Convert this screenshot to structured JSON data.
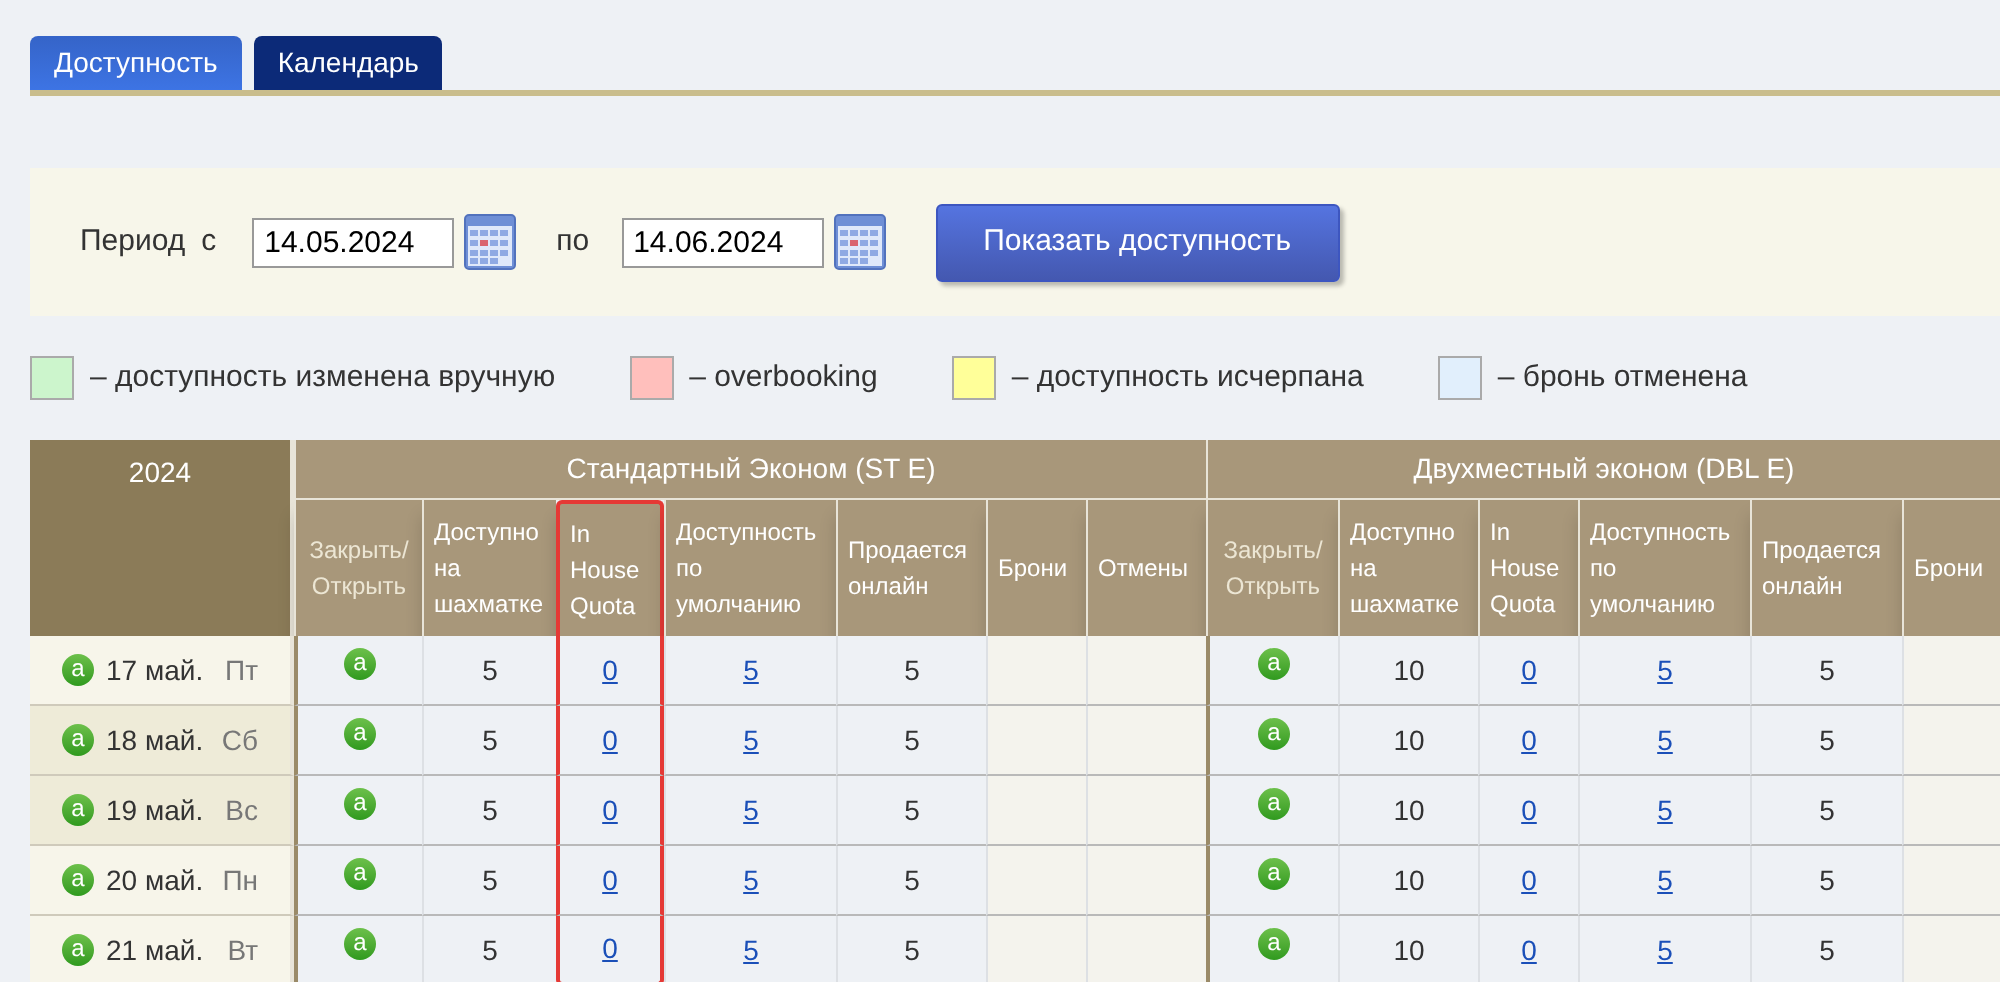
{
  "tabs": [
    {
      "label": "Доступность",
      "selected": true
    },
    {
      "label": "Календарь",
      "selected": false
    }
  ],
  "filter": {
    "period_label": "Период",
    "from_label": "с",
    "from_value": "14.05.2024",
    "to_label": "по",
    "to_value": "14.06.2024",
    "button": "Показать доступность"
  },
  "legend": [
    {
      "color": "#ccf5cc",
      "label": "– доступность изменена вручную"
    },
    {
      "color": "#ffbfbc",
      "label": "– overbooking"
    },
    {
      "color": "#ffff99",
      "label": "– доступность исчерпана"
    },
    {
      "color": "#e1effc",
      "label": "– бронь отменена"
    }
  ],
  "table": {
    "year": "2024",
    "groups": [
      {
        "name": "Стандартный Эконом (ST E)",
        "columns": [
          {
            "label": "Закрыть/ Открыть",
            "highlighted": false
          },
          {
            "label": "Доступно на шахматке",
            "highlighted": false
          },
          {
            "label": "In House Quota",
            "highlighted": true
          },
          {
            "label": "Доступность по умолчанию",
            "highlighted": false
          },
          {
            "label": "Продается онлайн",
            "highlighted": false
          },
          {
            "label": "Брони",
            "highlighted": false
          },
          {
            "label": "Отмены",
            "highlighted": false
          }
        ]
      },
      {
        "name": "Двухместный эконом (DBL E)",
        "columns": [
          {
            "label": "Закрыть/ Открыть",
            "highlighted": false
          },
          {
            "label": "Доступно на шахматке",
            "highlighted": false
          },
          {
            "label": "In House Quota",
            "highlighted": false
          },
          {
            "label": "Доступность по умолчанию",
            "highlighted": false
          },
          {
            "label": "Продается онлайн",
            "highlighted": false
          },
          {
            "label": "Брони",
            "highlighted": false
          }
        ]
      }
    ],
    "rows": [
      {
        "status": "a",
        "date": "17 май.",
        "weekday": "Пт",
        "weekend": false,
        "cells": [
          [
            {
              "kind": "icon",
              "text": "a"
            },
            {
              "kind": "plain",
              "text": "5"
            },
            {
              "kind": "link",
              "text": "0"
            },
            {
              "kind": "link",
              "text": "5"
            },
            {
              "kind": "plain",
              "text": "5"
            }
          ],
          [
            {
              "kind": "icon",
              "text": "a"
            },
            {
              "kind": "plain",
              "text": "10"
            },
            {
              "kind": "link",
              "text": "0"
            },
            {
              "kind": "link",
              "text": "5"
            },
            {
              "kind": "plain",
              "text": "5"
            }
          ]
        ]
      },
      {
        "status": "a",
        "date": "18 май.",
        "weekday": "Сб",
        "weekend": true,
        "cells": [
          [
            {
              "kind": "icon",
              "text": "a"
            },
            {
              "kind": "plain",
              "text": "5"
            },
            {
              "kind": "link",
              "text": "0"
            },
            {
              "kind": "link",
              "text": "5"
            },
            {
              "kind": "plain",
              "text": "5"
            }
          ],
          [
            {
              "kind": "icon",
              "text": "a"
            },
            {
              "kind": "plain",
              "text": "10"
            },
            {
              "kind": "link",
              "text": "0"
            },
            {
              "kind": "link",
              "text": "5"
            },
            {
              "kind": "plain",
              "text": "5"
            }
          ]
        ]
      },
      {
        "status": "a",
        "date": "19 май.",
        "weekday": "Вс",
        "weekend": true,
        "cells": [
          [
            {
              "kind": "icon",
              "text": "a"
            },
            {
              "kind": "plain",
              "text": "5"
            },
            {
              "kind": "link",
              "text": "0"
            },
            {
              "kind": "link",
              "text": "5"
            },
            {
              "kind": "plain",
              "text": "5"
            }
          ],
          [
            {
              "kind": "icon",
              "text": "a"
            },
            {
              "kind": "plain",
              "text": "10"
            },
            {
              "kind": "link",
              "text": "0"
            },
            {
              "kind": "link",
              "text": "5"
            },
            {
              "kind": "plain",
              "text": "5"
            }
          ]
        ]
      },
      {
        "status": "a",
        "date": "20 май.",
        "weekday": "Пн",
        "weekend": false,
        "cells": [
          [
            {
              "kind": "icon",
              "text": "a"
            },
            {
              "kind": "plain",
              "text": "5"
            },
            {
              "kind": "link",
              "text": "0"
            },
            {
              "kind": "link",
              "text": "5"
            },
            {
              "kind": "plain",
              "text": "5"
            }
          ],
          [
            {
              "kind": "icon",
              "text": "a"
            },
            {
              "kind": "plain",
              "text": "10"
            },
            {
              "kind": "link",
              "text": "0"
            },
            {
              "kind": "link",
              "text": "5"
            },
            {
              "kind": "plain",
              "text": "5"
            }
          ]
        ]
      },
      {
        "status": "a",
        "date": "21 май.",
        "weekday": "Вт",
        "weekend": false,
        "cells": [
          [
            {
              "kind": "icon",
              "text": "a"
            },
            {
              "kind": "plain",
              "text": "5"
            },
            {
              "kind": "link",
              "text": "0"
            },
            {
              "kind": "link",
              "text": "5"
            },
            {
              "kind": "plain",
              "text": "5"
            }
          ],
          [
            {
              "kind": "icon",
              "text": "a"
            },
            {
              "kind": "plain",
              "text": "10"
            },
            {
              "kind": "link",
              "text": "0"
            },
            {
              "kind": "link",
              "text": "5"
            },
            {
              "kind": "plain",
              "text": "5"
            }
          ]
        ]
      }
    ]
  }
}
